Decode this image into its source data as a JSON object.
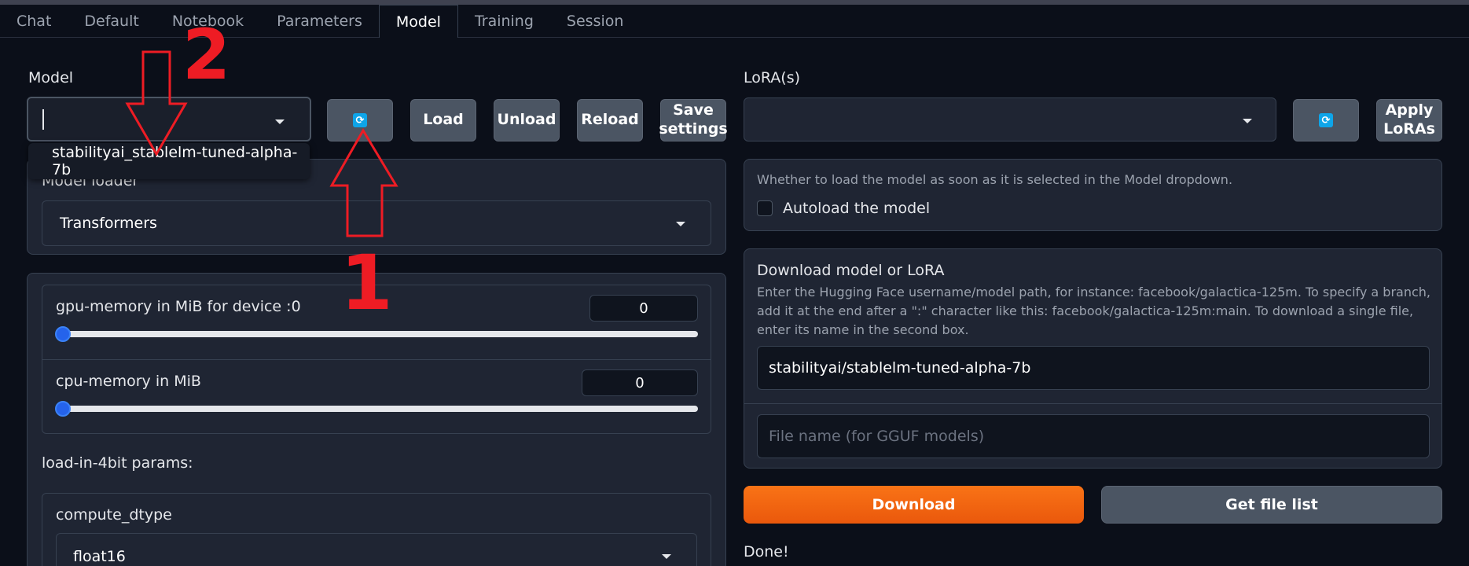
{
  "tabs": [
    {
      "label": "Chat"
    },
    {
      "label": "Default"
    },
    {
      "label": "Notebook"
    },
    {
      "label": "Parameters"
    },
    {
      "label": "Model",
      "active": true
    },
    {
      "label": "Training"
    },
    {
      "label": "Session"
    }
  ],
  "model": {
    "label": "Model",
    "input_value": "",
    "dropdown_option": "stabilityai_stablelm-tuned-alpha-7b",
    "refresh_icon": "refresh-icon",
    "buttons": {
      "load": "Load",
      "unload": "Unload",
      "reload": "Reload",
      "save_settings": "Save settings"
    }
  },
  "loader": {
    "label": "Model loader",
    "value": "Transformers"
  },
  "memory": {
    "gpu_label": "gpu-memory in MiB for device :0",
    "gpu_value": "0",
    "cpu_label": "cpu-memory in MiB",
    "cpu_value": "0"
  },
  "fourbit": {
    "label": "load-in-4bit params:",
    "compute_dtype_label": "compute_dtype",
    "compute_dtype_value": "float16"
  },
  "lora": {
    "label": "LoRA(s)",
    "value": "",
    "refresh_icon": "refresh-icon",
    "apply_button": "Apply LoRAs"
  },
  "autoload": {
    "description": "Whether to load the model as soon as it is selected in the Model dropdown.",
    "checkbox_label": "Autoload the model",
    "checked": false
  },
  "download": {
    "title": "Download model or LoRA",
    "description": "Enter the Hugging Face username/model path, for instance: facebook/galactica-125m. To specify a branch, add it at the end after a \":\" character like this: facebook/galactica-125m:main. To download a single file, enter its name in the second box.",
    "repo_value": "stabilityai/stablelm-tuned-alpha-7b",
    "file_placeholder": "File name (for GGUF models)",
    "download_button": "Download",
    "file_list_button": "Get file list",
    "status": "Done!"
  },
  "annotations": {
    "arrow_1_label": "1",
    "arrow_2_label": "2",
    "color": "#ee1c24"
  }
}
